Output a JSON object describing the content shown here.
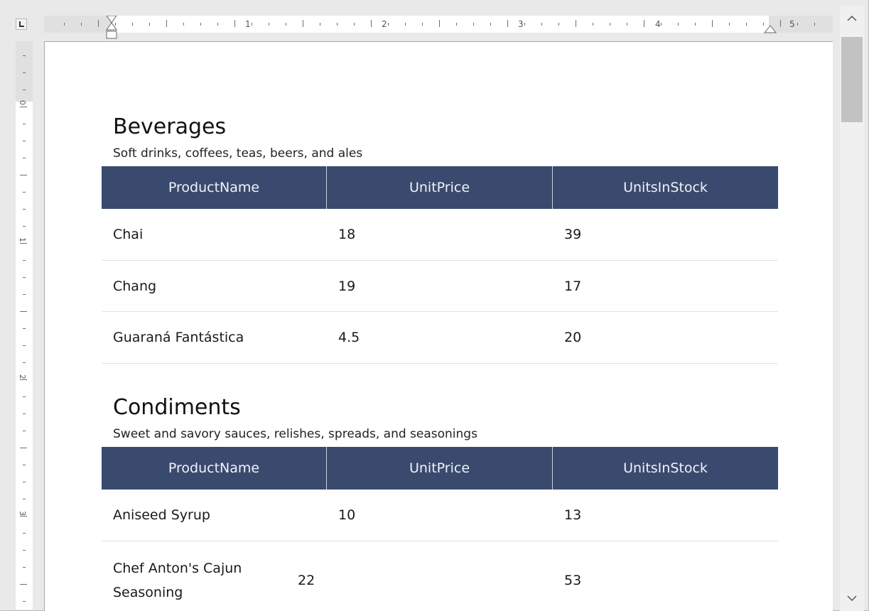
{
  "ruler": {
    "numbers": [
      "1",
      "2",
      "3",
      "4",
      "5"
    ]
  },
  "vertical_ruler": {
    "numbers": [
      "0",
      "1",
      "2",
      "3"
    ]
  },
  "columns": [
    "ProductName",
    "UnitPrice",
    "UnitsInStock"
  ],
  "categories": [
    {
      "title": "Beverages",
      "description": "Soft drinks, coffees, teas, beers, and ales",
      "rows": [
        {
          "name": "Chai",
          "price": "18",
          "stock": "39"
        },
        {
          "name": "Chang",
          "price": "19",
          "stock": "17"
        },
        {
          "name": "Guaraná Fantástica",
          "price": "4.5",
          "stock": "20"
        }
      ]
    },
    {
      "title": "Condiments",
      "description": "Sweet and savory sauces, relishes, spreads, and seasonings",
      "rows": [
        {
          "name": "Aniseed Syrup",
          "price": "10",
          "stock": "13"
        },
        {
          "name": "Chef Anton's Cajun Seasoning",
          "price": "22",
          "stock": "53"
        }
      ]
    }
  ],
  "icons": {
    "scroll_up": "chevron-up-icon",
    "scroll_down": "chevron-down-icon",
    "tab_stop": "tab-stop-icon"
  }
}
